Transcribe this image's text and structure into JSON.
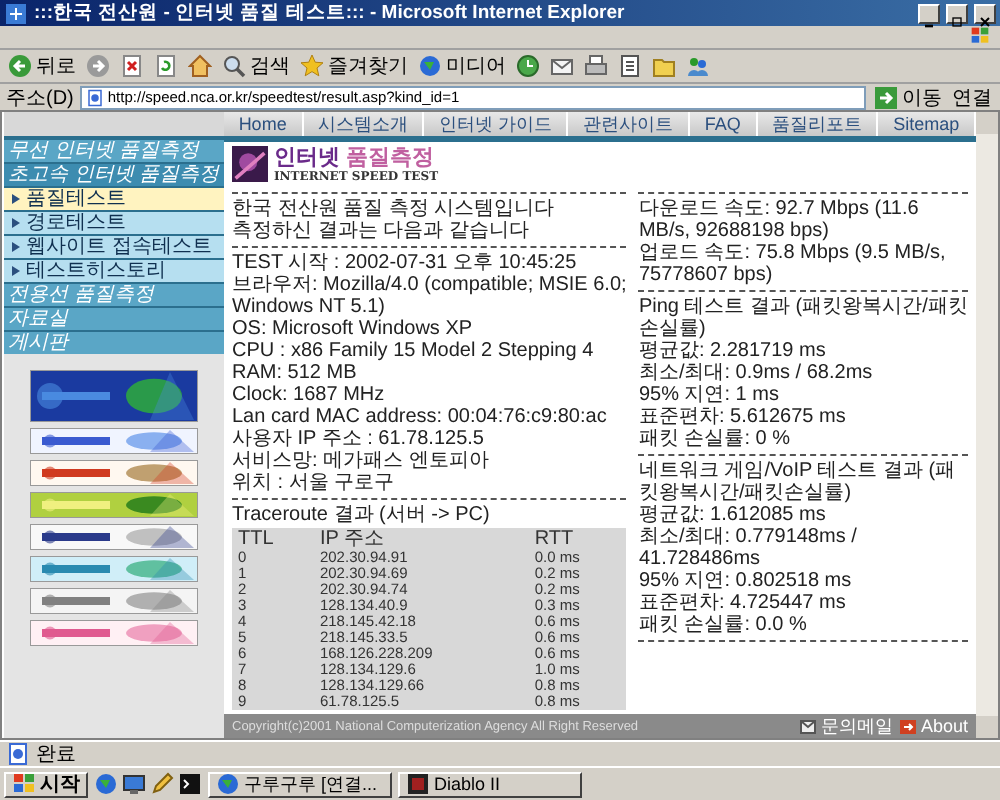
{
  "window": {
    "title": ":::한국 전산원 - 인터넷 품질 테스트::: - Microsoft Internet Explorer"
  },
  "toolbar": [
    {
      "kind": "back",
      "label": "뒤로"
    },
    {
      "kind": "forward"
    },
    {
      "kind": "stop"
    },
    {
      "kind": "refresh"
    },
    {
      "kind": "home"
    },
    {
      "kind": "search",
      "label": "검색"
    },
    {
      "kind": "favorites",
      "label": "즐겨찾기"
    },
    {
      "kind": "media",
      "label": "미디어"
    },
    {
      "kind": "history"
    },
    {
      "kind": "mail"
    },
    {
      "kind": "print"
    },
    {
      "kind": "edit"
    },
    {
      "kind": "folder"
    },
    {
      "kind": "messenger"
    }
  ],
  "address_bar": {
    "label": "주소(D)",
    "url": "http://speed.nca.or.kr/speedtest/result.asp?kind_id=1",
    "go": "이동",
    "links": "연결"
  },
  "site": {
    "nav": [
      "Home",
      "시스템소개",
      "인터넷 가이드",
      "관련사이트",
      "FAQ",
      "품질리포트",
      "Sitemap"
    ],
    "sidebar": [
      {
        "kind": "section",
        "label": "무선 인터넷 품질측정",
        "selected": false
      },
      {
        "kind": "section",
        "label": "초고속 인터넷 품질측정",
        "selected": true
      },
      {
        "kind": "sub",
        "label": "품질테스트",
        "selected": true
      },
      {
        "kind": "sub",
        "label": "경로테스트",
        "selected": false
      },
      {
        "kind": "sub",
        "label": "웹사이트 접속테스트",
        "selected": false
      },
      {
        "kind": "sub",
        "label": "테스트히스토리",
        "selected": false
      },
      {
        "kind": "section",
        "label": "전용선 품질측정",
        "selected": false
      },
      {
        "kind": "section",
        "label": "자료실",
        "selected": false
      },
      {
        "kind": "section",
        "label": "게시판",
        "selected": false
      }
    ],
    "banners": [
      {
        "kind": "picture"
      },
      {
        "kind": "picture"
      },
      {
        "kind": "picture"
      },
      {
        "kind": "picture"
      },
      {
        "kind": "picture"
      },
      {
        "kind": "picture"
      },
      {
        "kind": "picture"
      },
      {
        "kind": "picture"
      }
    ],
    "logo": {
      "words": [
        "인터넷",
        "품질측정"
      ],
      "subtitle": "INTERNET SPEED TEST"
    },
    "intro": [
      "한국 전산원 품질 측정 시스템입니다",
      "측정하신 결과는 다음과 같습니다"
    ],
    "system": [
      "TEST 시작 : 2002-07-31 오후 10:45:25",
      "브라우저: Mozilla/4.0 (compatible; MSIE 6.0; Windows NT 5.1)",
      "OS: Microsoft Windows XP",
      "CPU : x86 Family 15 Model 2 Stepping 4",
      "RAM: 512 MB",
      "Clock: 1687 MHz",
      "Lan card MAC address: 00:04:76:c9:80:ac",
      "사용자 IP 주소 : 61.78.125.5",
      "서비스망: 메가패스 엔토피아",
      "위치 : 서울 구로구"
    ],
    "speed": [
      "다운로드 속도: 92.7 Mbps (11.6 MB/s, 92688198 bps)",
      "업로드 속도: 75.8 Mbps (9.5 MB/s, 75778607 bps)"
    ],
    "ping": {
      "title": "Ping 테스트 결과 (패킷왕복시간/패킷손실률)",
      "lines": [
        "평균값: 2.281719 ms",
        "최소/최대: 0.9ms / 68.2ms",
        "95% 지연: 1 ms",
        "표준편차: 5.612675 ms",
        "패킷 손실률: 0 %"
      ]
    },
    "voip": {
      "title": "네트워크 게임/VoIP 테스트 결과 (패킷왕복시간/패킷손실률)",
      "lines": [
        "평균값: 1.612085 ms",
        "최소/최대: 0.779148ms / 41.728486ms",
        "95% 지연: 0.802518 ms",
        "표준편차: 4.725447 ms",
        "패킷 손실률: 0.0 %"
      ]
    },
    "traceroute": {
      "title": "Traceroute 결과 (서버 -> PC)",
      "columns": [
        "TTL",
        "IP 주소",
        "RTT"
      ],
      "rows": [
        [
          "0",
          "202.30.94.91",
          "0.0 ms"
        ],
        [
          "1",
          "202.30.94.69",
          "0.2 ms"
        ],
        [
          "2",
          "202.30.94.74",
          "0.2 ms"
        ],
        [
          "3",
          "128.134.40.9",
          "0.3 ms"
        ],
        [
          "4",
          "218.145.42.18",
          "0.6 ms"
        ],
        [
          "5",
          "218.145.33.5",
          "0.6 ms"
        ],
        [
          "6",
          "168.126.228.209",
          "0.6 ms"
        ],
        [
          "7",
          "128.134.129.6",
          "1.0 ms"
        ],
        [
          "8",
          "128.134.129.66",
          "0.8 ms"
        ],
        [
          "9",
          "61.78.125.5",
          "0.8 ms"
        ]
      ]
    },
    "footer": {
      "copyright": "Copyright(c)2001 National Computerization Agency All Right Reserved",
      "mail": "문의메일",
      "about": "About"
    }
  },
  "status_bar": {
    "text": "완료"
  },
  "taskbar": {
    "start": "시작",
    "tasks": [
      "구루구루 [연결...",
      "Diablo II"
    ]
  }
}
